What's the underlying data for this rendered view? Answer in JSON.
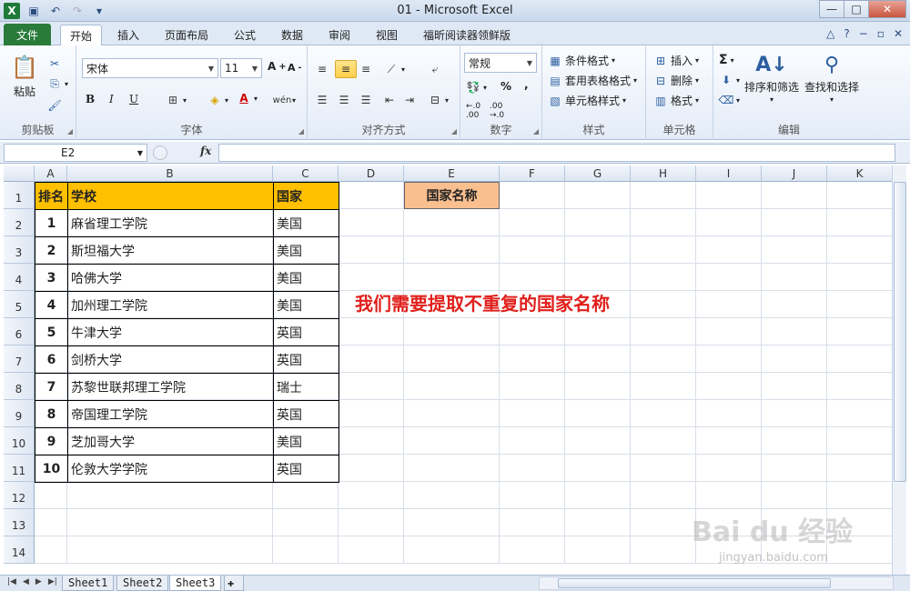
{
  "window": {
    "title": "01  -  Microsoft Excel"
  },
  "tabs": [
    "文件",
    "开始",
    "插入",
    "页面布局",
    "公式",
    "数据",
    "审阅",
    "视图",
    "福昕阅读器领鲜版"
  ],
  "ribbon": {
    "clipboard": {
      "label": "剪贴板",
      "paste": "粘贴"
    },
    "font": {
      "label": "字体",
      "name": "宋体",
      "size": "11",
      "bold": "B",
      "italic": "I",
      "underline": "U"
    },
    "align": {
      "label": "对齐方式"
    },
    "number": {
      "label": "数字",
      "format": "常规",
      "percent": "%",
      "comma": ","
    },
    "styles": {
      "label": "样式",
      "cond": "条件格式",
      "table": "套用表格格式",
      "cell": "单元格样式"
    },
    "cells": {
      "label": "单元格",
      "insert": "插入",
      "delete": "删除",
      "format": "格式"
    },
    "edit": {
      "label": "编辑",
      "sort": "排序和筛选",
      "find": "查找和选择",
      "sigma": "Σ"
    }
  },
  "formula": {
    "namebox": "E2",
    "fx": "fx",
    "value": ""
  },
  "columns": [
    "A",
    "B",
    "C",
    "D",
    "E",
    "F",
    "G",
    "H",
    "I",
    "J",
    "K"
  ],
  "rows": [
    "1",
    "2",
    "3",
    "4",
    "5",
    "6",
    "7",
    "8",
    "9",
    "10",
    "11",
    "12",
    "13",
    "14"
  ],
  "table": {
    "headers": [
      "排名",
      "学校",
      "国家"
    ],
    "rows": [
      [
        "1",
        "麻省理工学院",
        "美国"
      ],
      [
        "2",
        "斯坦福大学",
        "美国"
      ],
      [
        "3",
        "哈佛大学",
        "美国"
      ],
      [
        "4",
        "加州理工学院",
        "美国"
      ],
      [
        "5",
        "牛津大学",
        "英国"
      ],
      [
        "6",
        "剑桥大学",
        "英国"
      ],
      [
        "7",
        "苏黎世联邦理工学院",
        "瑞士"
      ],
      [
        "8",
        "帝国理工学院",
        "英国"
      ],
      [
        "9",
        "芝加哥大学",
        "美国"
      ],
      [
        "10",
        "伦敦大学学院",
        "英国"
      ]
    ]
  },
  "e1": "国家名称",
  "note": "我们需要提取不重复的国家名称",
  "sheets": [
    "Sheet1",
    "Sheet2",
    "Sheet3"
  ],
  "watermark": {
    "main": "Bai du 经验",
    "sub": "jingyan.baidu.com"
  },
  "colors": {
    "header": "#ffc000",
    "e1": "#f9bf8f",
    "note": "#e0201c"
  }
}
